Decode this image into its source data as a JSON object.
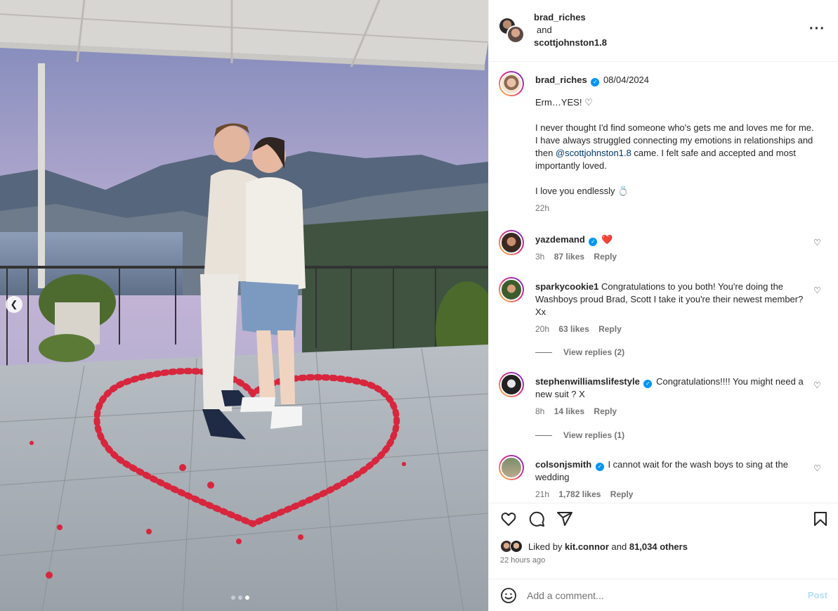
{
  "post": {
    "collaborators": [
      "brad_riches",
      "scottjohnston1.8"
    ],
    "and_label": "and",
    "more_icon": "more-horizontal-icon"
  },
  "caption": {
    "username": "brad_riches",
    "date": "08/04/2024",
    "line1": "Erm…YES! ♡",
    "para_start": "I never thought I'd find someone who's gets me and loves me for me. I have always struggled connecting my emotions in relationships and then ",
    "mention": "@scottjohnston1.8",
    "para_end": " came. I felt safe and accepted and most importantly loved.",
    "line3": "I love you endlessly 💍",
    "time": "22h"
  },
  "comments": [
    {
      "username": "yazdemand",
      "text": "❤️",
      "time": "3h",
      "likes": "87 likes",
      "reply": "Reply",
      "verified": true
    },
    {
      "username": "sparkycookie1",
      "text": "Congratulations to you both! You're doing the Washboys proud Brad, Scott I take it you're their newest member? Xx",
      "time": "20h",
      "likes": "63 likes",
      "reply": "Reply",
      "verified": false,
      "view_replies": "View replies (2)"
    },
    {
      "username": "stephenwilliamslifestyle",
      "text": "Congratulations!!!! You might need a new suit ? X",
      "time": "8h",
      "likes": "14 likes",
      "reply": "Reply",
      "verified": true,
      "view_replies": "View replies (1)"
    },
    {
      "username": "colsonjsmith",
      "text": "I cannot wait for the wash boys to sing at the wedding",
      "time": "21h",
      "likes": "1,782 likes",
      "reply": "Reply",
      "verified": true
    }
  ],
  "engagement": {
    "liked_prefix": "Liked by",
    "liked_user": "kit.connor",
    "liked_and": "and",
    "liked_count": "81,034 others",
    "timestamp": "22 hours ago"
  },
  "composer": {
    "placeholder": "Add a comment...",
    "post_label": "Post"
  },
  "carousel": {
    "total": 3,
    "active": 3
  },
  "colors": {
    "accent": "#0095f6",
    "heart": "#ff3040",
    "mention": "#00376b"
  }
}
